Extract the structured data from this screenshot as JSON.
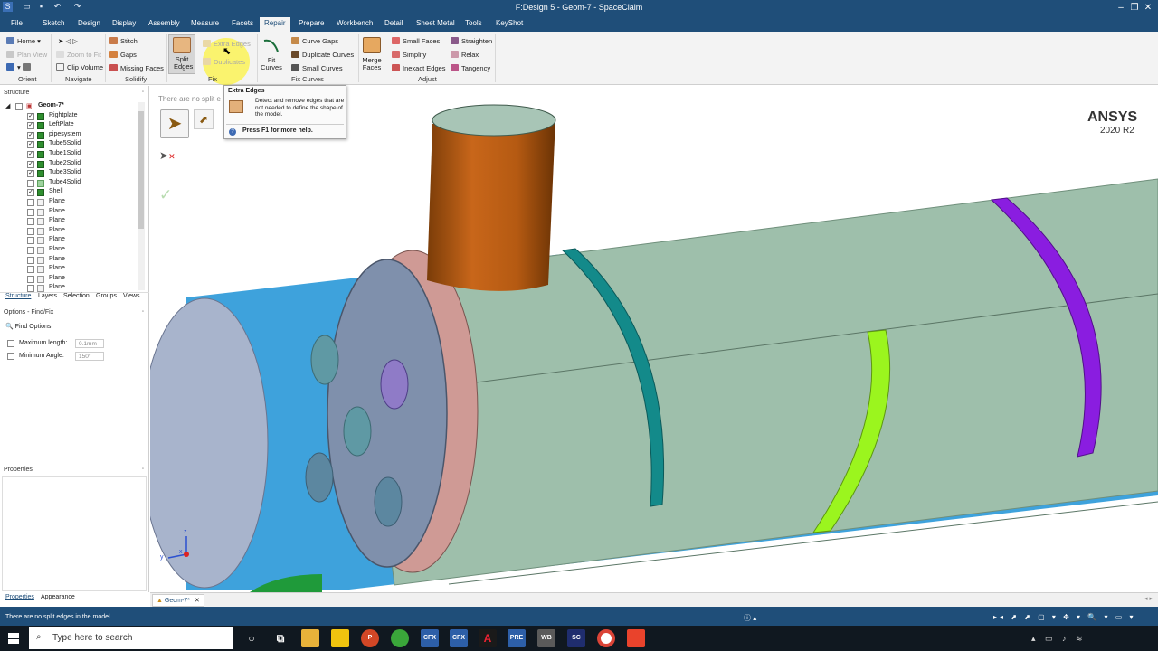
{
  "window": {
    "title": "F:Design 5 - Geom-7 - SpaceClaim",
    "minimize": "–",
    "restore": "❐",
    "close": "✕"
  },
  "menu": {
    "tabs": [
      "File",
      "Sketch",
      "Design",
      "Display",
      "Assembly",
      "Measure",
      "Facets",
      "Repair",
      "Prepare",
      "Workbench",
      "Detail",
      "Sheet Metal",
      "Tools",
      "KeyShot"
    ],
    "active": "Repair"
  },
  "ribbon": {
    "home": "Home",
    "plan_view": "Plan View",
    "zoom_to_fit": "Zoom to Fit",
    "clip_volume": "Clip Volume",
    "stitch": "Stitch",
    "gaps": "Gaps",
    "missing_faces": "Missing Faces",
    "split_edges": "Split Edges",
    "extra_edges": "Extra Edges",
    "duplicates": "Duplicates",
    "fit_curves": "Fit Curves",
    "curve_gaps": "Curve Gaps",
    "duplicate_curves": "Duplicate Curves",
    "small_curves": "Small Curves",
    "merge_faces": "Merge Faces",
    "small_faces": "Small Faces",
    "simplify": "Simplify",
    "inexact_edges": "Inexact Edges",
    "straighten": "Straighten",
    "relax": "Relax",
    "tangency": "Tangency",
    "groups": {
      "orient": "Orient",
      "navigate": "Navigate",
      "solidify": "Solidify",
      "fix": "Fix",
      "fix_curves": "Fix Curves",
      "adjust": "Adjust"
    }
  },
  "tooltip": {
    "title": "Extra Edges",
    "body": "Detect and remove edges that are not needed to define the shape of the model.",
    "help": "Press F1 for more help."
  },
  "structure": {
    "header": "Structure",
    "root": "Geom-7*",
    "items": [
      {
        "label": "Rightplate",
        "checked": true,
        "type": "solid"
      },
      {
        "label": "LeftPlate",
        "checked": true,
        "type": "solid"
      },
      {
        "label": "pipesystem",
        "checked": true,
        "type": "solid"
      },
      {
        "label": "Tube5Solid",
        "checked": true,
        "type": "solid"
      },
      {
        "label": "Tube1Solid",
        "checked": true,
        "type": "solid"
      },
      {
        "label": "Tube2Solid",
        "checked": true,
        "type": "solid"
      },
      {
        "label": "Tube3Solid",
        "checked": true,
        "type": "solid"
      },
      {
        "label": "Tube4Solid",
        "checked": false,
        "type": "solid-light"
      },
      {
        "label": "Shell",
        "checked": true,
        "type": "solid"
      },
      {
        "label": "Plane",
        "checked": false,
        "type": "plane"
      },
      {
        "label": "Plane",
        "checked": false,
        "type": "plane"
      },
      {
        "label": "Plane",
        "checked": false,
        "type": "plane"
      },
      {
        "label": "Plane",
        "checked": false,
        "type": "plane"
      },
      {
        "label": "Plane",
        "checked": false,
        "type": "plane"
      },
      {
        "label": "Plane",
        "checked": false,
        "type": "plane"
      },
      {
        "label": "Plane",
        "checked": false,
        "type": "plane"
      },
      {
        "label": "Plane",
        "checked": false,
        "type": "plane"
      },
      {
        "label": "Plane",
        "checked": false,
        "type": "plane"
      },
      {
        "label": "Plane",
        "checked": false,
        "type": "plane"
      }
    ],
    "tabs": [
      "Structure",
      "Layers",
      "Selection",
      "Groups",
      "Views"
    ]
  },
  "options": {
    "header": "Options - Find/Fix",
    "find_options": "Find Options",
    "max_length_label": "Maximum length:",
    "max_length_value": "0.1mm",
    "min_angle_label": "Minimum Angle:",
    "min_angle_value": "150°"
  },
  "properties": {
    "header": "Properties",
    "tabs": [
      "Properties",
      "Appearance"
    ]
  },
  "viewport": {
    "message": "There are no split e",
    "brand": "ANSYS",
    "version": "2020 R2",
    "triad": {
      "x": "x",
      "y": "y",
      "z": "z"
    }
  },
  "doc_tab": "Geom-7*",
  "status": {
    "message": "There are no split edges in the model"
  },
  "taskbar": {
    "search_placeholder": "Type here to search",
    "apps": [
      "CFX",
      "CFX",
      "A",
      "PRE",
      "WB",
      "SC"
    ]
  },
  "colors": {
    "accent": "#1f4e79",
    "body": "#9ebfab",
    "orange": "#b35a10",
    "teal": "#138a8a",
    "lime": "#9bf51e",
    "purple": "#8a1de0",
    "pink": "#cf9a95",
    "disc": "#7f90ac"
  }
}
